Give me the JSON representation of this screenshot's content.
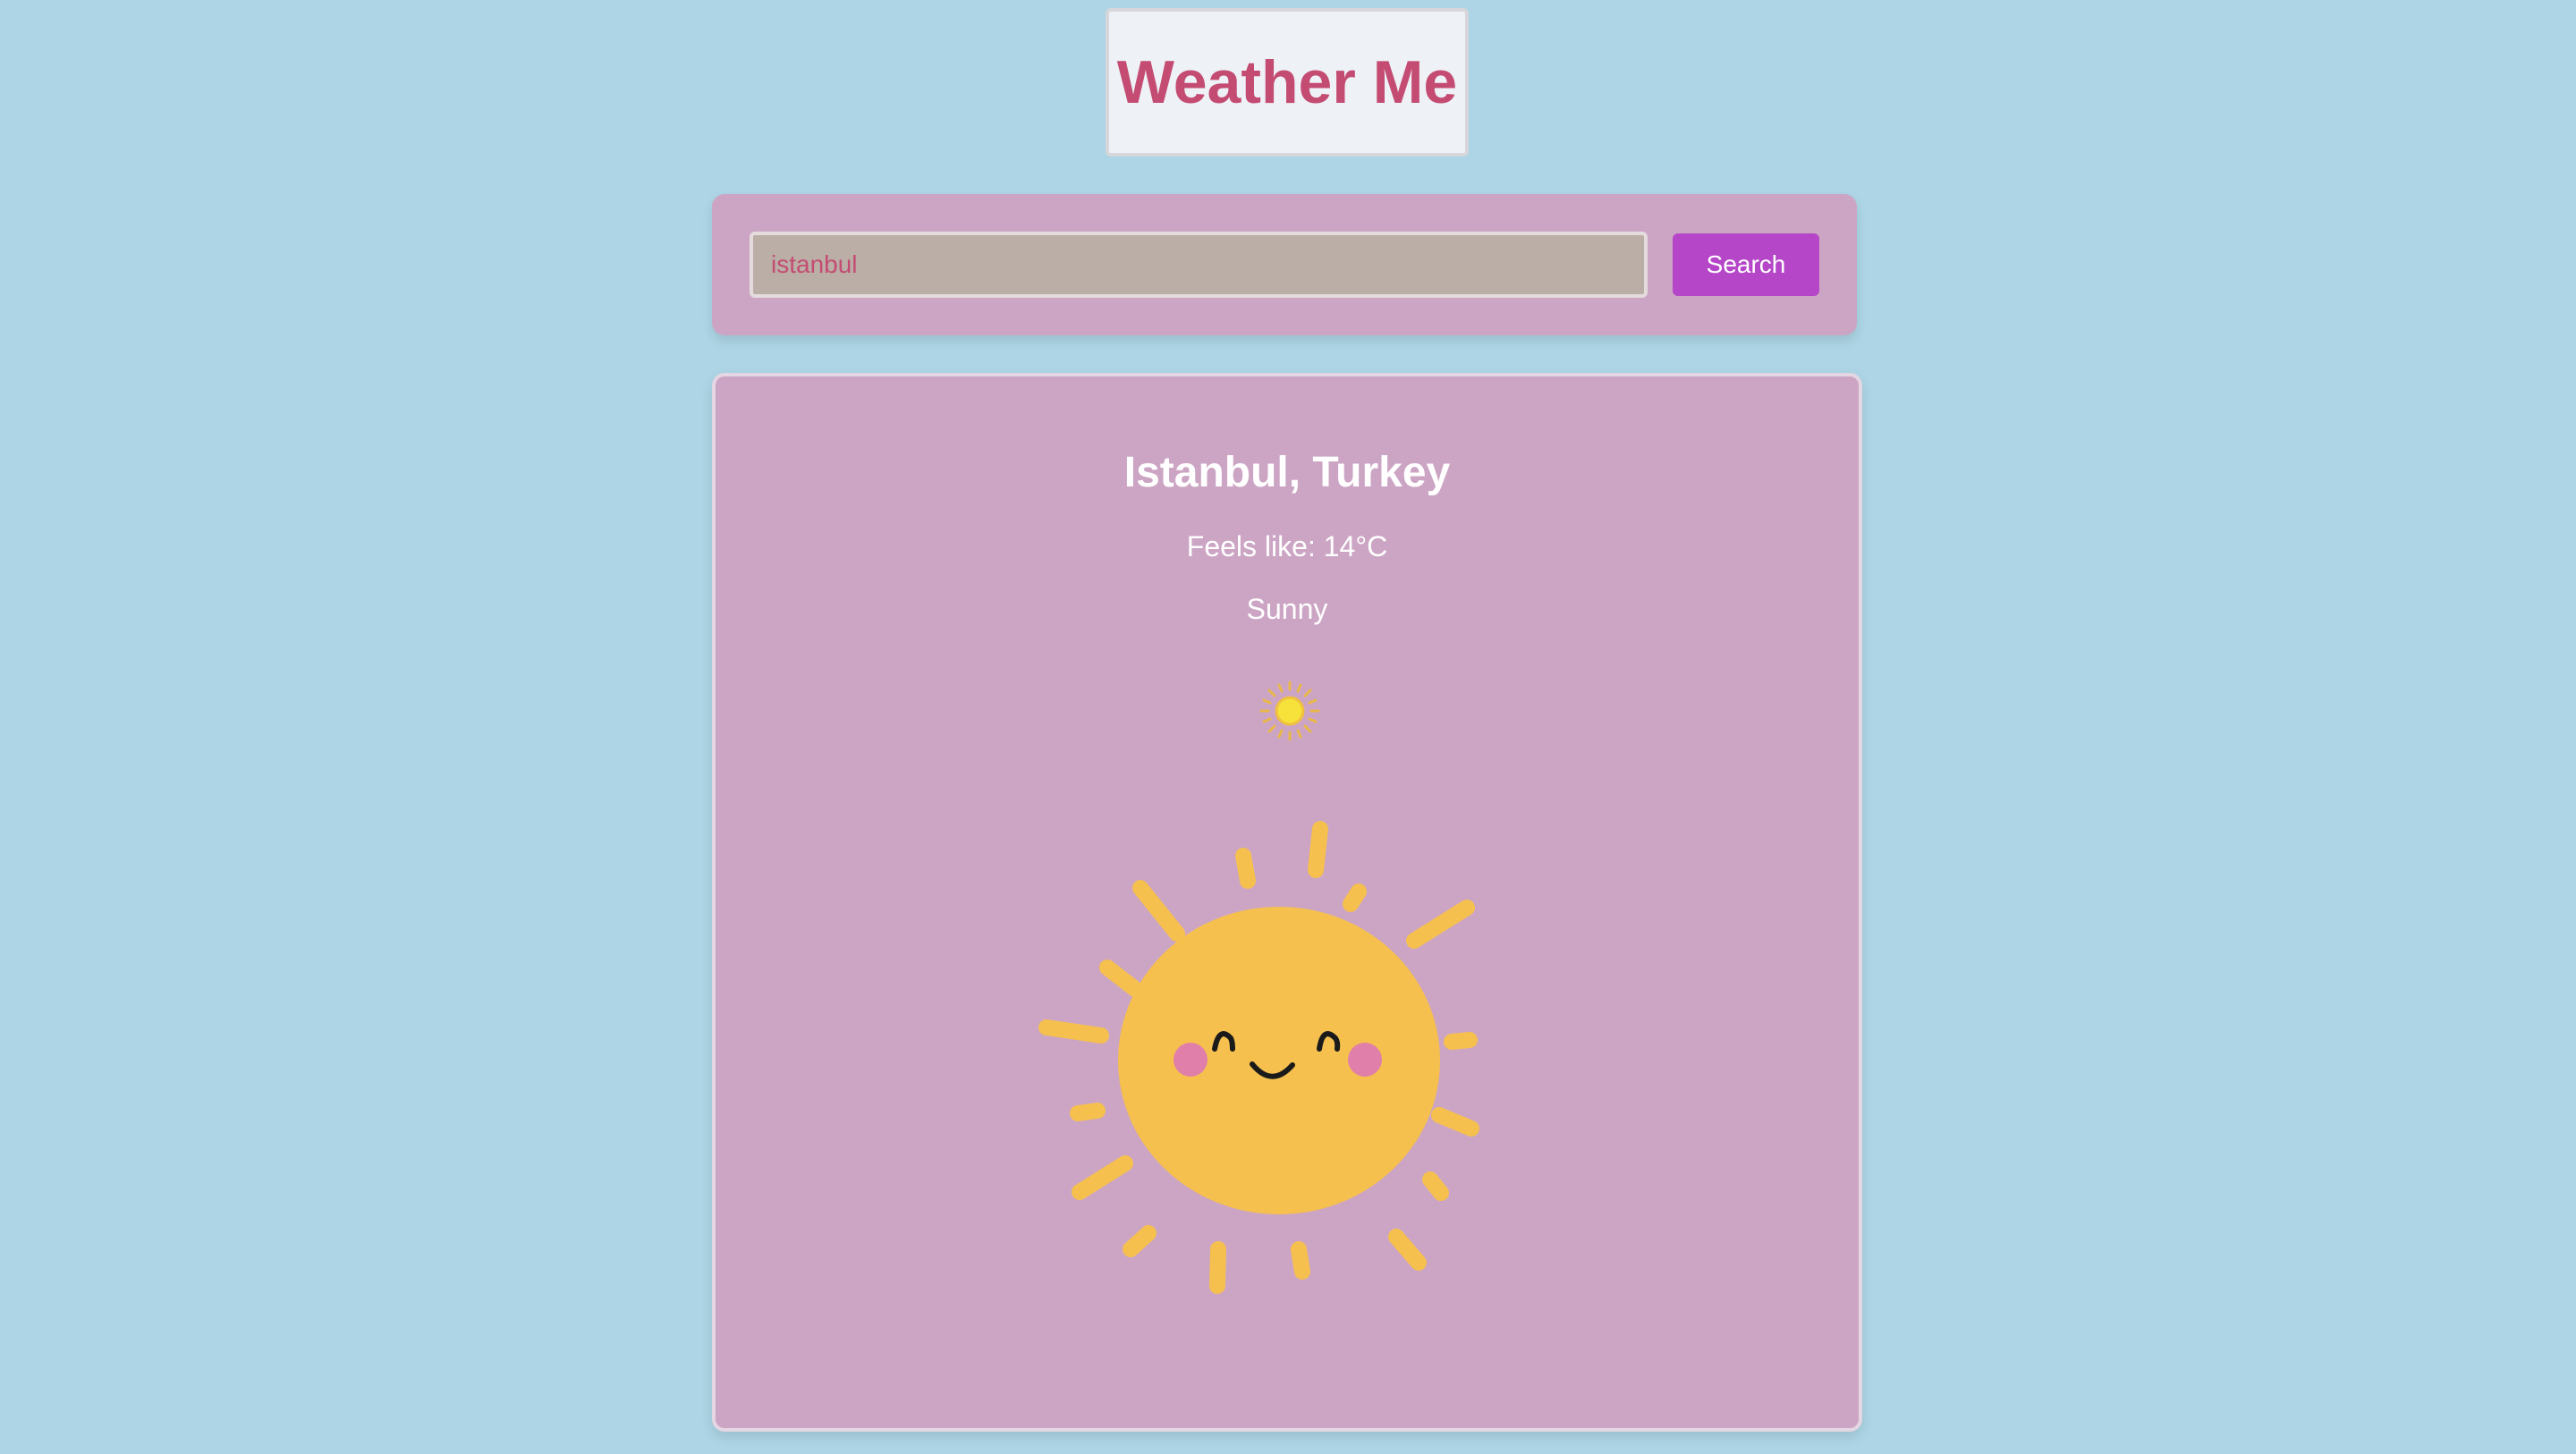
{
  "header": {
    "title": "Weather Me"
  },
  "search": {
    "value": "istanbul",
    "button_label": "Search"
  },
  "weather": {
    "location": "Istanbul, Turkey",
    "feels_like": "Feels like: 14°C",
    "condition": "Sunny",
    "condition_icon": "sun-icon",
    "illustration": "smiling-sun-illustration"
  },
  "colors": {
    "background": "#add5e5",
    "panel": "#cca5c4",
    "title_text": "#c44c73",
    "button": "#b546c8",
    "sun": "#f5c04e"
  }
}
